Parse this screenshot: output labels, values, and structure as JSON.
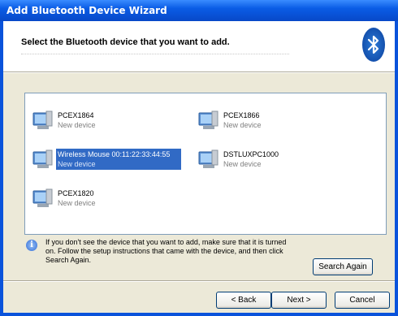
{
  "window": {
    "title": "Add Bluetooth Device Wizard"
  },
  "header": {
    "title": "Select the Bluetooth device that you want to add.",
    "logo_icon": "bluetooth-icon"
  },
  "devices": [
    {
      "name": "PCEX1864",
      "status": "New device",
      "selected": false
    },
    {
      "name": "PCEX1866",
      "status": "New device",
      "selected": false
    },
    {
      "name": "Wireless Mouse 00:11:22:33:44:55",
      "status": "New device",
      "selected": true
    },
    {
      "name": "DSTLUXPC1000",
      "status": "New device",
      "selected": false
    },
    {
      "name": "PCEX1820",
      "status": "New device",
      "selected": false
    }
  ],
  "info": {
    "icon": "info-icon",
    "text": "If you don't see the device that you want to add, make sure that it is turned on. Follow the setup instructions that came with the device, and then click Search Again."
  },
  "buttons": {
    "search_again": "Search Again",
    "back": "< Back",
    "next": "Next >",
    "cancel": "Cancel"
  },
  "colors": {
    "titlebar": "#0A5CE5",
    "selection": "#316AC5",
    "window_bg": "#ECE9D8"
  }
}
